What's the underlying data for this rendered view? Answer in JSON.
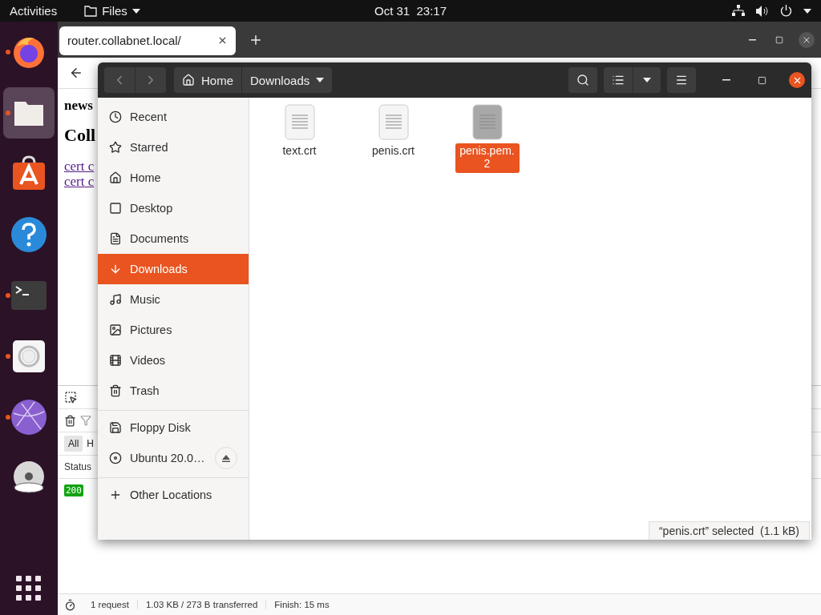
{
  "top_bar": {
    "activities": "Activities",
    "app_menu": "Files",
    "clock": "Oct 31  23:17"
  },
  "dock": {
    "items": [
      {
        "kind": "firefox",
        "running": true,
        "selected": false
      },
      {
        "kind": "files",
        "running": true,
        "selected": true
      },
      {
        "kind": "software",
        "running": false,
        "selected": false
      },
      {
        "kind": "help",
        "running": false,
        "selected": false
      },
      {
        "kind": "terminal",
        "running": true,
        "selected": false
      },
      {
        "kind": "settings",
        "running": true,
        "selected": false
      },
      {
        "kind": "globe",
        "running": true,
        "selected": false
      },
      {
        "kind": "dvd",
        "running": false,
        "selected": false
      }
    ]
  },
  "browser": {
    "tab": {
      "title": "router.collabnet.local/"
    },
    "page": {
      "heading_1": "news",
      "heading_2": "Coll",
      "links": [
        "cert c",
        "cert c"
      ]
    },
    "devtools": {
      "filters": [
        {
          "label": "All",
          "selected": true
        },
        {
          "label": "H",
          "selected": false
        }
      ],
      "columns": [
        "Status"
      ],
      "rows": [
        {
          "status": "200"
        }
      ],
      "status_bar": {
        "requests": "1 request",
        "transferred": "1.03 KB / 273 B transferred",
        "finish": "Finish: 15 ms"
      }
    }
  },
  "files": {
    "path": [
      {
        "label": "Home",
        "kind": "home"
      },
      {
        "label": "Downloads",
        "kind": "current"
      }
    ],
    "sidebar": {
      "places": [
        {
          "label": "Recent",
          "kind": "recent",
          "selected": false
        },
        {
          "label": "Starred",
          "kind": "starred",
          "selected": false
        },
        {
          "label": "Home",
          "kind": "home",
          "selected": false
        },
        {
          "label": "Desktop",
          "kind": "desktop",
          "selected": false
        },
        {
          "label": "Documents",
          "kind": "documents",
          "selected": false
        },
        {
          "label": "Downloads",
          "kind": "downloads",
          "selected": true
        },
        {
          "label": "Music",
          "kind": "music",
          "selected": false
        },
        {
          "label": "Pictures",
          "kind": "pictures",
          "selected": false
        },
        {
          "label": "Videos",
          "kind": "videos",
          "selected": false
        },
        {
          "label": "Trash",
          "kind": "trash",
          "selected": false
        }
      ],
      "devices": [
        {
          "label": "Floppy Disk",
          "kind": "floppy",
          "ejectable": false
        },
        {
          "label": "Ubuntu 20.0…",
          "kind": "disc",
          "ejectable": true
        }
      ],
      "other": {
        "label": "Other Locations"
      }
    },
    "items": [
      {
        "name": "text.crt",
        "selected": false
      },
      {
        "name": "penis.crt",
        "selected": false
      },
      {
        "name": "penis.pem.2",
        "selected": true
      }
    ],
    "status": "“penis.crt” selected  (1.1 kB)"
  }
}
